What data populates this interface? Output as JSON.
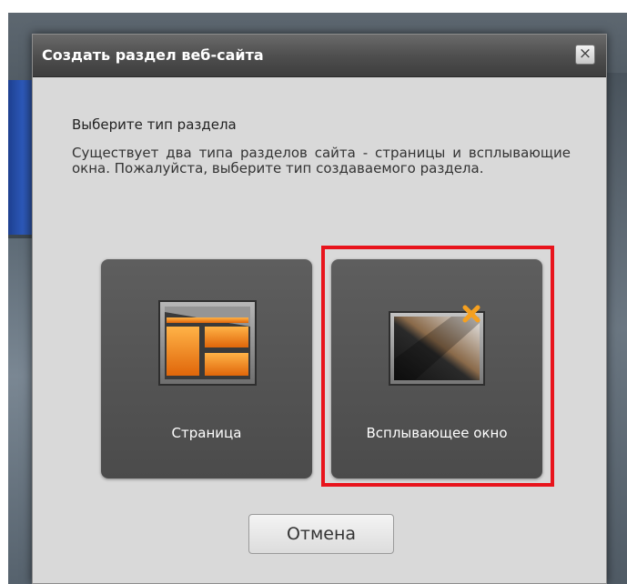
{
  "dialog": {
    "title": "Создать раздел веб-сайта",
    "close_label": "×",
    "heading": "Выберите тип раздела",
    "description": "Существует два типа разделов сайта - страницы и всплывающие окна. Пожалуйста, выберите тип создаваемого раздела.",
    "options": [
      {
        "label": "Страница",
        "icon": "page-layout-icon",
        "selected": false
      },
      {
        "label": "Всплывающее окно",
        "icon": "popup-window-icon",
        "selected": true
      }
    ],
    "cancel_label": "Отмена"
  },
  "colors": {
    "highlight": "#e8141c",
    "tile": "#555555",
    "accent": "#f5841f"
  }
}
